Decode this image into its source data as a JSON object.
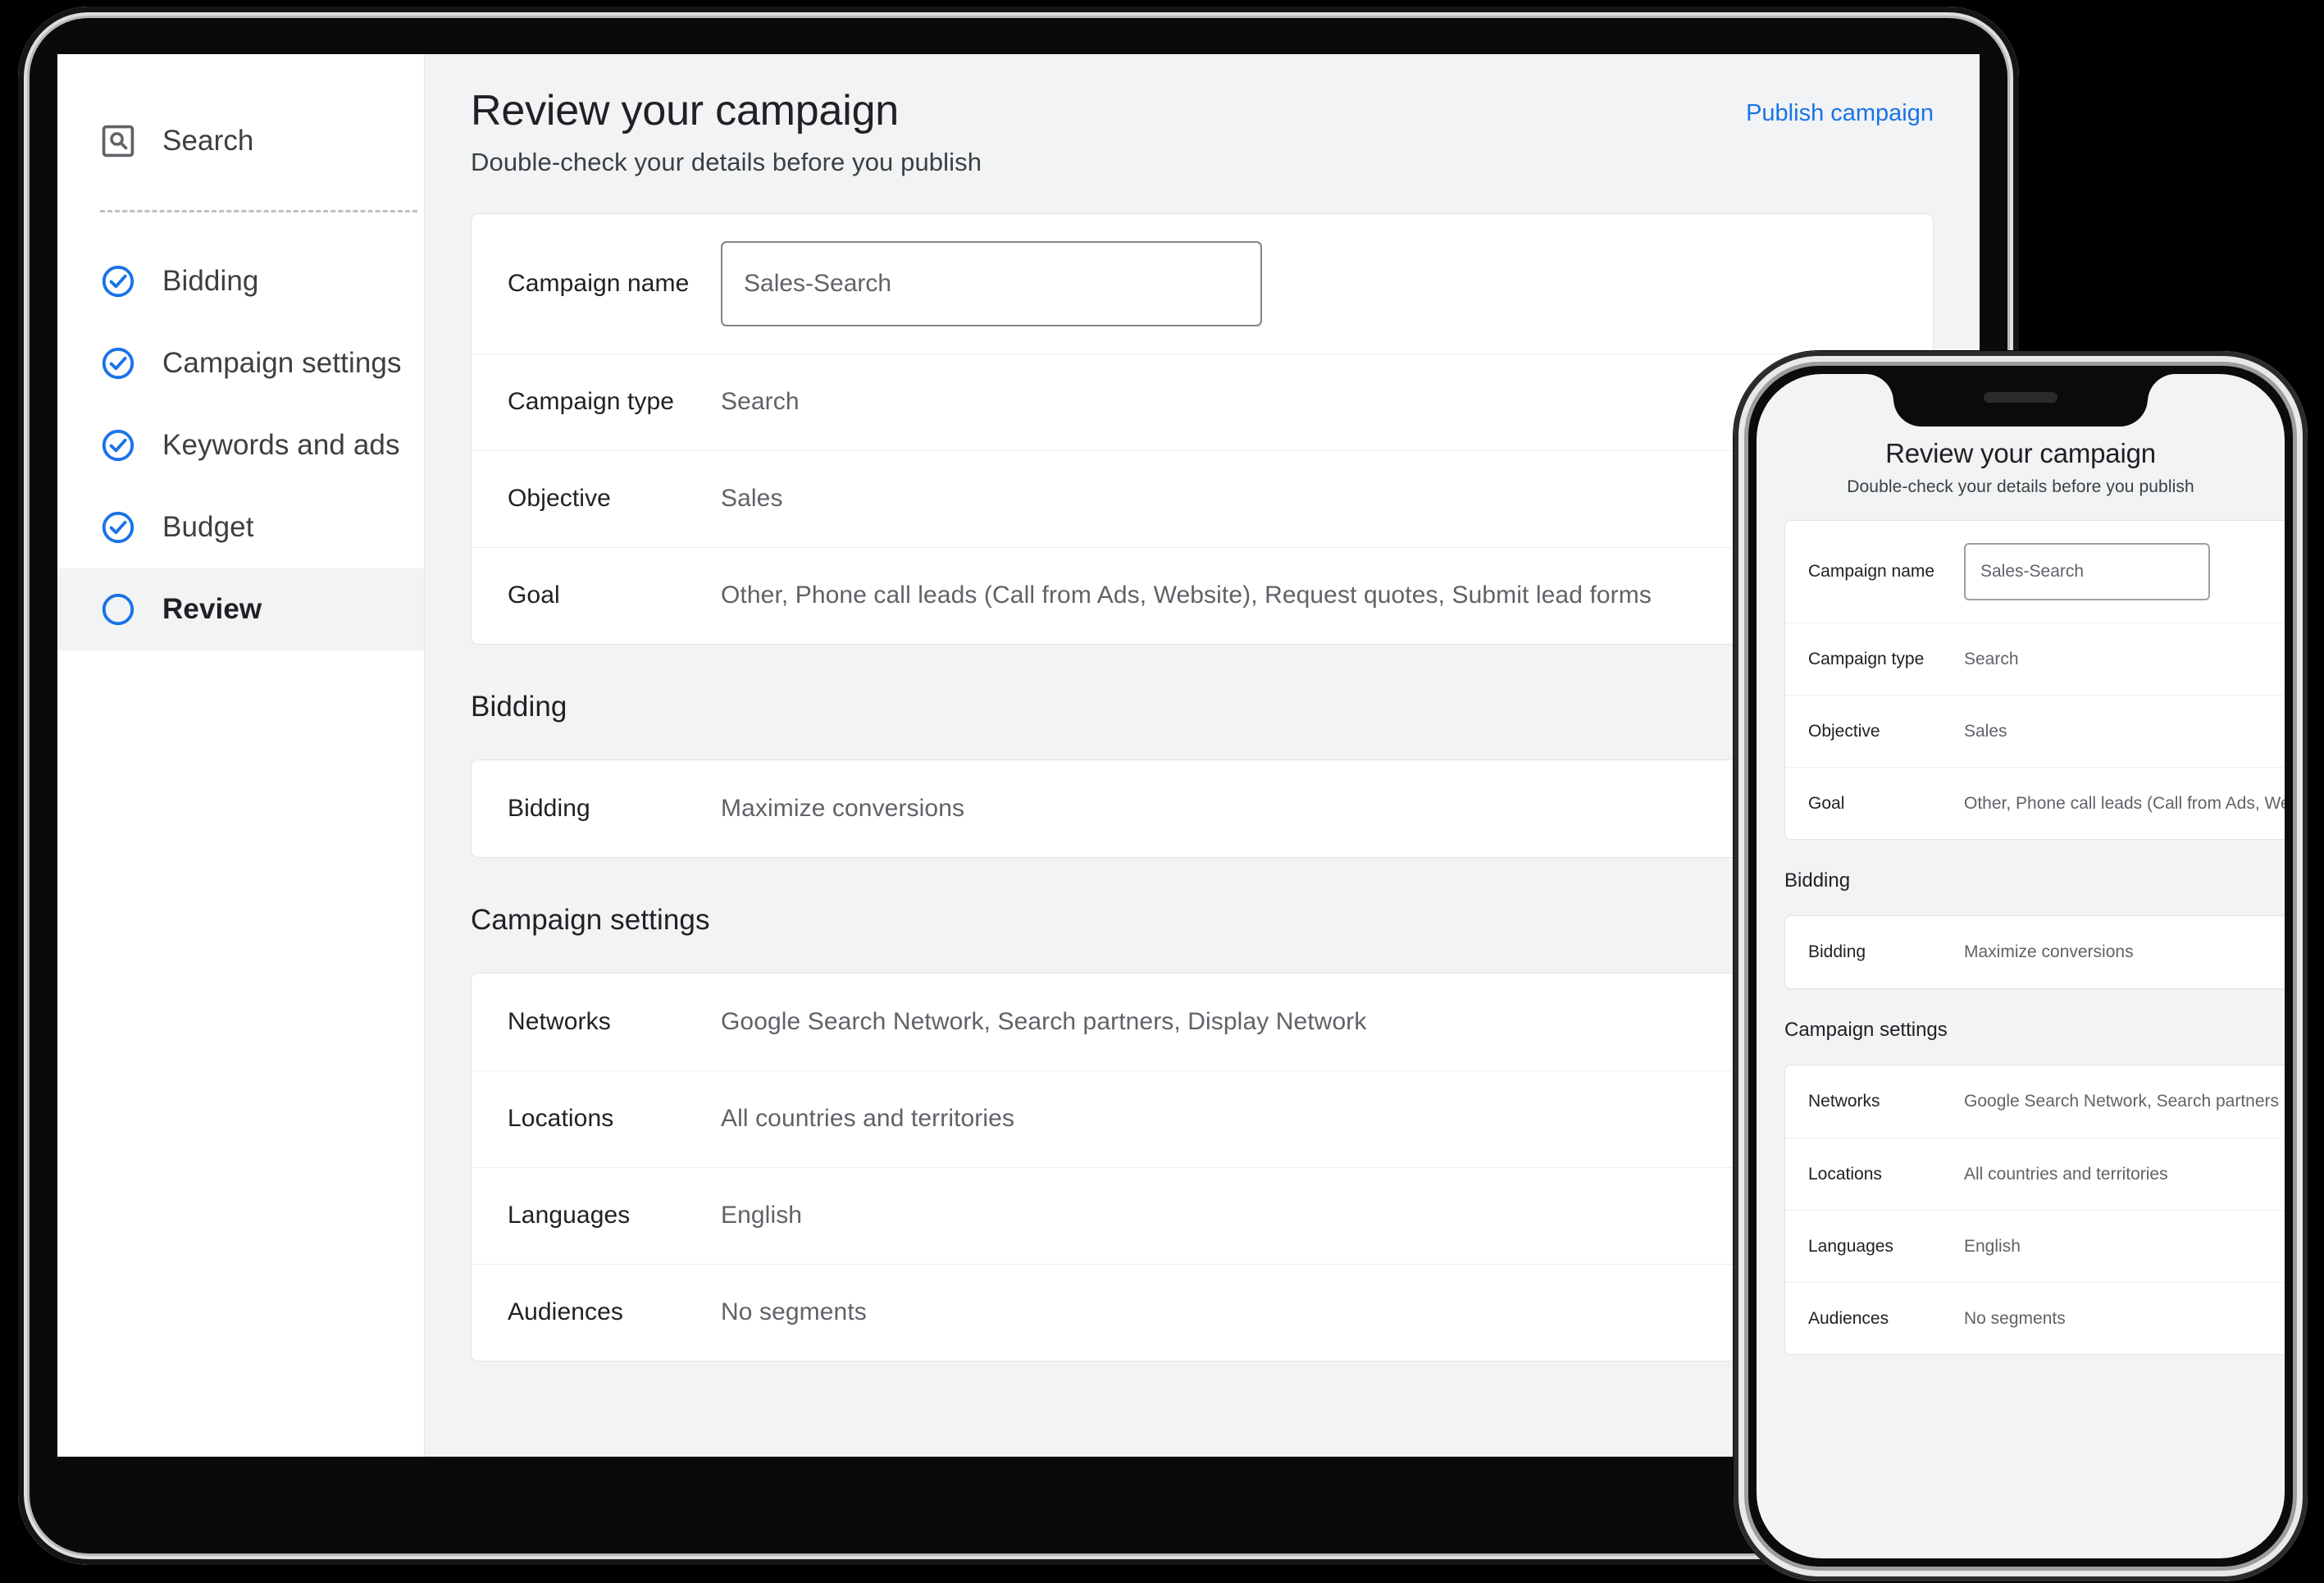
{
  "sidebar": {
    "items": [
      {
        "label": "Search",
        "icon": "search-box-icon",
        "state": "current-type"
      },
      {
        "label": "Bidding",
        "icon": "check-circle-icon",
        "state": "complete"
      },
      {
        "label": "Campaign settings",
        "icon": "check-circle-icon",
        "state": "complete"
      },
      {
        "label": "Keywords and ads",
        "icon": "check-circle-icon",
        "state": "complete"
      },
      {
        "label": "Budget",
        "icon": "check-circle-icon",
        "state": "complete"
      },
      {
        "label": "Review",
        "icon": "empty-circle-icon",
        "state": "active"
      }
    ]
  },
  "header": {
    "title": "Review your campaign",
    "subtitle": "Double-check your details before you publish",
    "publish_label": "Publish campaign"
  },
  "details_card": {
    "campaign_name": {
      "label": "Campaign name",
      "value": "Sales-Search",
      "placeholder": "Campaign name"
    },
    "rows": [
      {
        "label": "Campaign type",
        "value": "Search"
      },
      {
        "label": "Objective",
        "value": "Sales"
      },
      {
        "label": "Goal",
        "value": "Other, Phone call leads (Call from Ads, Website), Request quotes, Submit lead forms"
      }
    ]
  },
  "bidding_section": {
    "heading": "Bidding",
    "rows": [
      {
        "label": "Bidding",
        "value": "Maximize conversions"
      }
    ]
  },
  "campaign_settings_section": {
    "heading": "Campaign settings",
    "rows": [
      {
        "label": "Networks",
        "value": "Google Search Network, Search partners, Display Network"
      },
      {
        "label": "Locations",
        "value": "All countries and territories"
      },
      {
        "label": "Languages",
        "value": "English"
      },
      {
        "label": "Audiences",
        "value": "No segments"
      }
    ]
  },
  "phone": {
    "title": "Review your campaign",
    "subtitle": "Double-check your details before you publish",
    "details": {
      "campaign_name": {
        "label": "Campaign name",
        "value": "Sales-Search"
      },
      "rows": [
        {
          "label": "Campaign type",
          "value": "Search"
        },
        {
          "label": "Objective",
          "value": "Sales"
        },
        {
          "label": "Goal",
          "value": "Other, Phone call leads (Call from Ads, Website), Request quotes"
        }
      ]
    },
    "bidding_heading": "Bidding",
    "bidding_rows": [
      {
        "label": "Bidding",
        "value": "Maximize conversions"
      }
    ],
    "settings_heading": "Campaign settings",
    "settings_rows": [
      {
        "label": "Networks",
        "value": "Google Search Network, Search partners"
      },
      {
        "label": "Locations",
        "value": "All countries and territories"
      },
      {
        "label": "Languages",
        "value": "English"
      },
      {
        "label": "Audiences",
        "value": "No segments"
      }
    ]
  },
  "colors": {
    "accent": "#1a73e8",
    "panel_bg": "#f1f3f4",
    "text_primary": "#202124",
    "text_secondary": "#5f6368",
    "card_border": "#e0e2e4"
  }
}
